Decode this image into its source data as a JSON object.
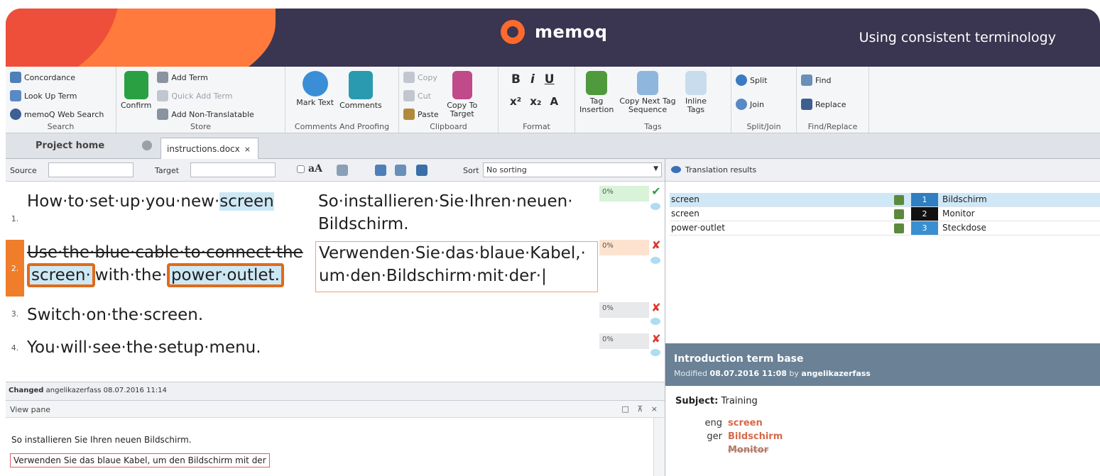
{
  "banner": {
    "logo_text": "memoq",
    "title": "Using consistent terminology"
  },
  "ribbon": {
    "search": {
      "concordance": "Concordance",
      "lookup": "Look Up Term",
      "web": "memoQ Web Search",
      "title": "Search"
    },
    "store": {
      "confirm": "Confirm",
      "add_term": "Add Term",
      "quick_add": "Quick Add Term",
      "add_nt": "Add Non-Translatable",
      "title": "Store"
    },
    "comments": {
      "mark": "Mark Text",
      "comments": "Comments",
      "title": "Comments And Proofing"
    },
    "clipboard": {
      "copy": "Copy",
      "cut": "Cut",
      "paste": "Paste",
      "copy_to_target": "Copy To Target",
      "title": "Clipboard"
    },
    "format": {
      "bold": "B",
      "italic": "i",
      "underline": "U",
      "sup": "x²",
      "sub": "x₂",
      "font": "A",
      "title": "Format"
    },
    "tags": {
      "insertion": "Tag Insertion",
      "copy_next": "Copy Next Tag Sequence",
      "inline": "Inline Tags",
      "title": "Tags"
    },
    "splitjoin": {
      "split": "Split",
      "join": "Join",
      "title": "Split/Join"
    },
    "findreplace": {
      "find": "Find",
      "replace": "Replace",
      "title": "Find/Replace"
    }
  },
  "tabs": {
    "home": "Project home",
    "doc": "instructions.docx",
    "close": "×"
  },
  "filter": {
    "source_label": "Source",
    "target_label": "Target",
    "case": "aA",
    "sort_label": "Sort",
    "sort_value": "No sorting"
  },
  "segments": [
    {
      "num": "1.",
      "pct": "0%",
      "status": "✔"
    },
    {
      "num": "2.",
      "pct": "0%",
      "status": "✘"
    },
    {
      "num": "3.",
      "pct": "0%",
      "status": "✘",
      "source": "Switch·on·the·screen."
    },
    {
      "num": "4.",
      "pct": "0%",
      "status": "✘",
      "source": "You·will·see·the·setup·menu."
    }
  ],
  "seg1": {
    "src_pre": "How·to·set·up·you·new·",
    "src_term": "screen",
    "tgt": "So·installieren·Sie·Ihren·neuen· Bildschirm."
  },
  "seg2": {
    "src_strike": "Use·the·blue·cable·to·connect·the",
    "src_term1": "screen·",
    "src_mid": "with·the·",
    "src_term2": "power·outlet.",
    "tgt": "Verwenden·Sie·das·blaue·Kabel,· um·den·Bildschirm·mit·der·|"
  },
  "statusline": {
    "label": "Changed",
    "value": "angelikazerfass 08.07.2016 11:14"
  },
  "viewpane": {
    "title": "View pane",
    "controls": "□ ⊼ ×",
    "line1": "So installieren Sie Ihren neuen Bildschirm.",
    "line2": "Verwenden Sie das blaue Kabel, um den Bildschirm mit der"
  },
  "translation_results": {
    "title": "Translation results",
    "rows": [
      {
        "term": "screen",
        "num": "1",
        "target": "Bildschirm",
        "color": "#2f7fc1"
      },
      {
        "term": "screen",
        "num": "2",
        "target": "Monitor",
        "color": "#111111"
      },
      {
        "term": "power·outlet",
        "num": "3",
        "target": "Steckdose",
        "color": "#3a8fd1"
      }
    ]
  },
  "termbase": {
    "title": "Introduction term base",
    "mod_prefix": "Modified",
    "mod_date": "08.07.2016 11:08",
    "mod_by": "by",
    "mod_user": "angelikazerfass",
    "subject_label": "Subject:",
    "subject": "Training",
    "eng_lang": "eng",
    "eng_term": "screen",
    "ger_lang": "ger",
    "ger_term1": "Bildschirm",
    "ger_term2": "Monitor"
  },
  "colors": {
    "banner": "#3a3550",
    "accent": "#ff6a2c",
    "term_highlight": "#cde8f5",
    "orange_box": "#e06a1a",
    "confirm_green": "#2aa043",
    "reject_red": "#e0342a"
  }
}
